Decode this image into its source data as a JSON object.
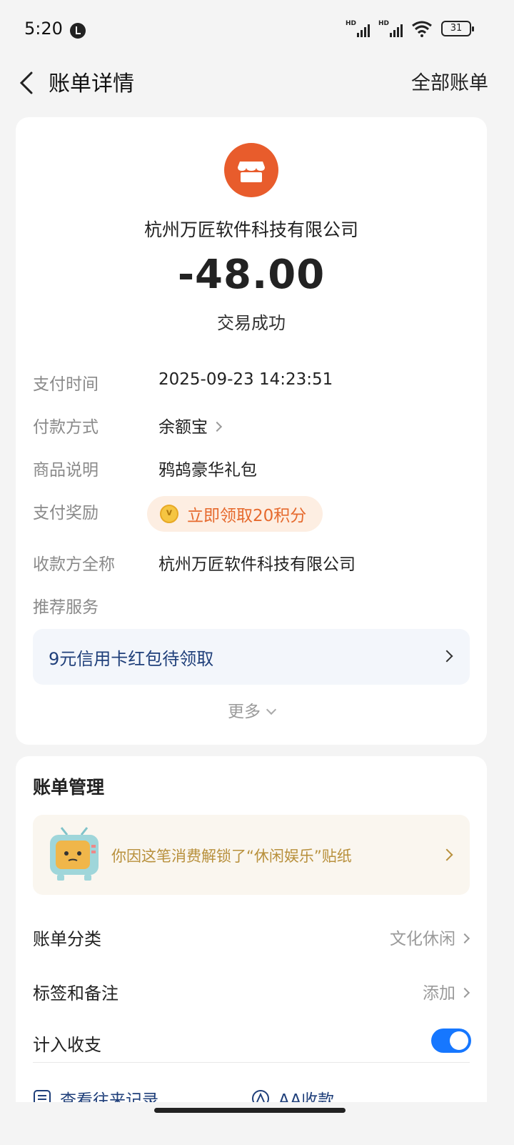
{
  "status_bar": {
    "time": "5:20",
    "battery": "31"
  },
  "header": {
    "title": "账单详情",
    "right_link": "全部账单"
  },
  "bill": {
    "merchant": "杭州万匠软件科技有限公司",
    "amount": "-48.00",
    "status": "交易成功",
    "rows": {
      "pay_time": {
        "label": "支付时间",
        "value": "2025-09-23 14:23:51"
      },
      "pay_method": {
        "label": "付款方式",
        "value": "余额宝"
      },
      "item_desc": {
        "label": "商品说明",
        "value": "鸦鸪豪华礼包"
      },
      "reward": {
        "label": "支付奖励",
        "value": "立即领取20积分"
      },
      "payee": {
        "label": "收款方全称",
        "value": "杭州万匠软件科技有限公司"
      },
      "recommend": {
        "label": "推荐服务"
      }
    },
    "promo": "9元信用卡红包待领取",
    "more": "更多"
  },
  "management": {
    "title": "账单管理",
    "sticker_text": "你因这笔消费解锁了“休闲娱乐”贴纸",
    "category": {
      "label": "账单分类",
      "value": "文化休闲"
    },
    "tags": {
      "label": "标签和备注",
      "value": "添加"
    },
    "count_in": {
      "label": "计入收支",
      "enabled": true
    },
    "actions": {
      "history": "查看往来记录",
      "aa": "AA收款"
    }
  },
  "colors": {
    "accent": "#1677ff",
    "merchant_logo": "#e85c2c",
    "reward": "#e66a2e"
  }
}
